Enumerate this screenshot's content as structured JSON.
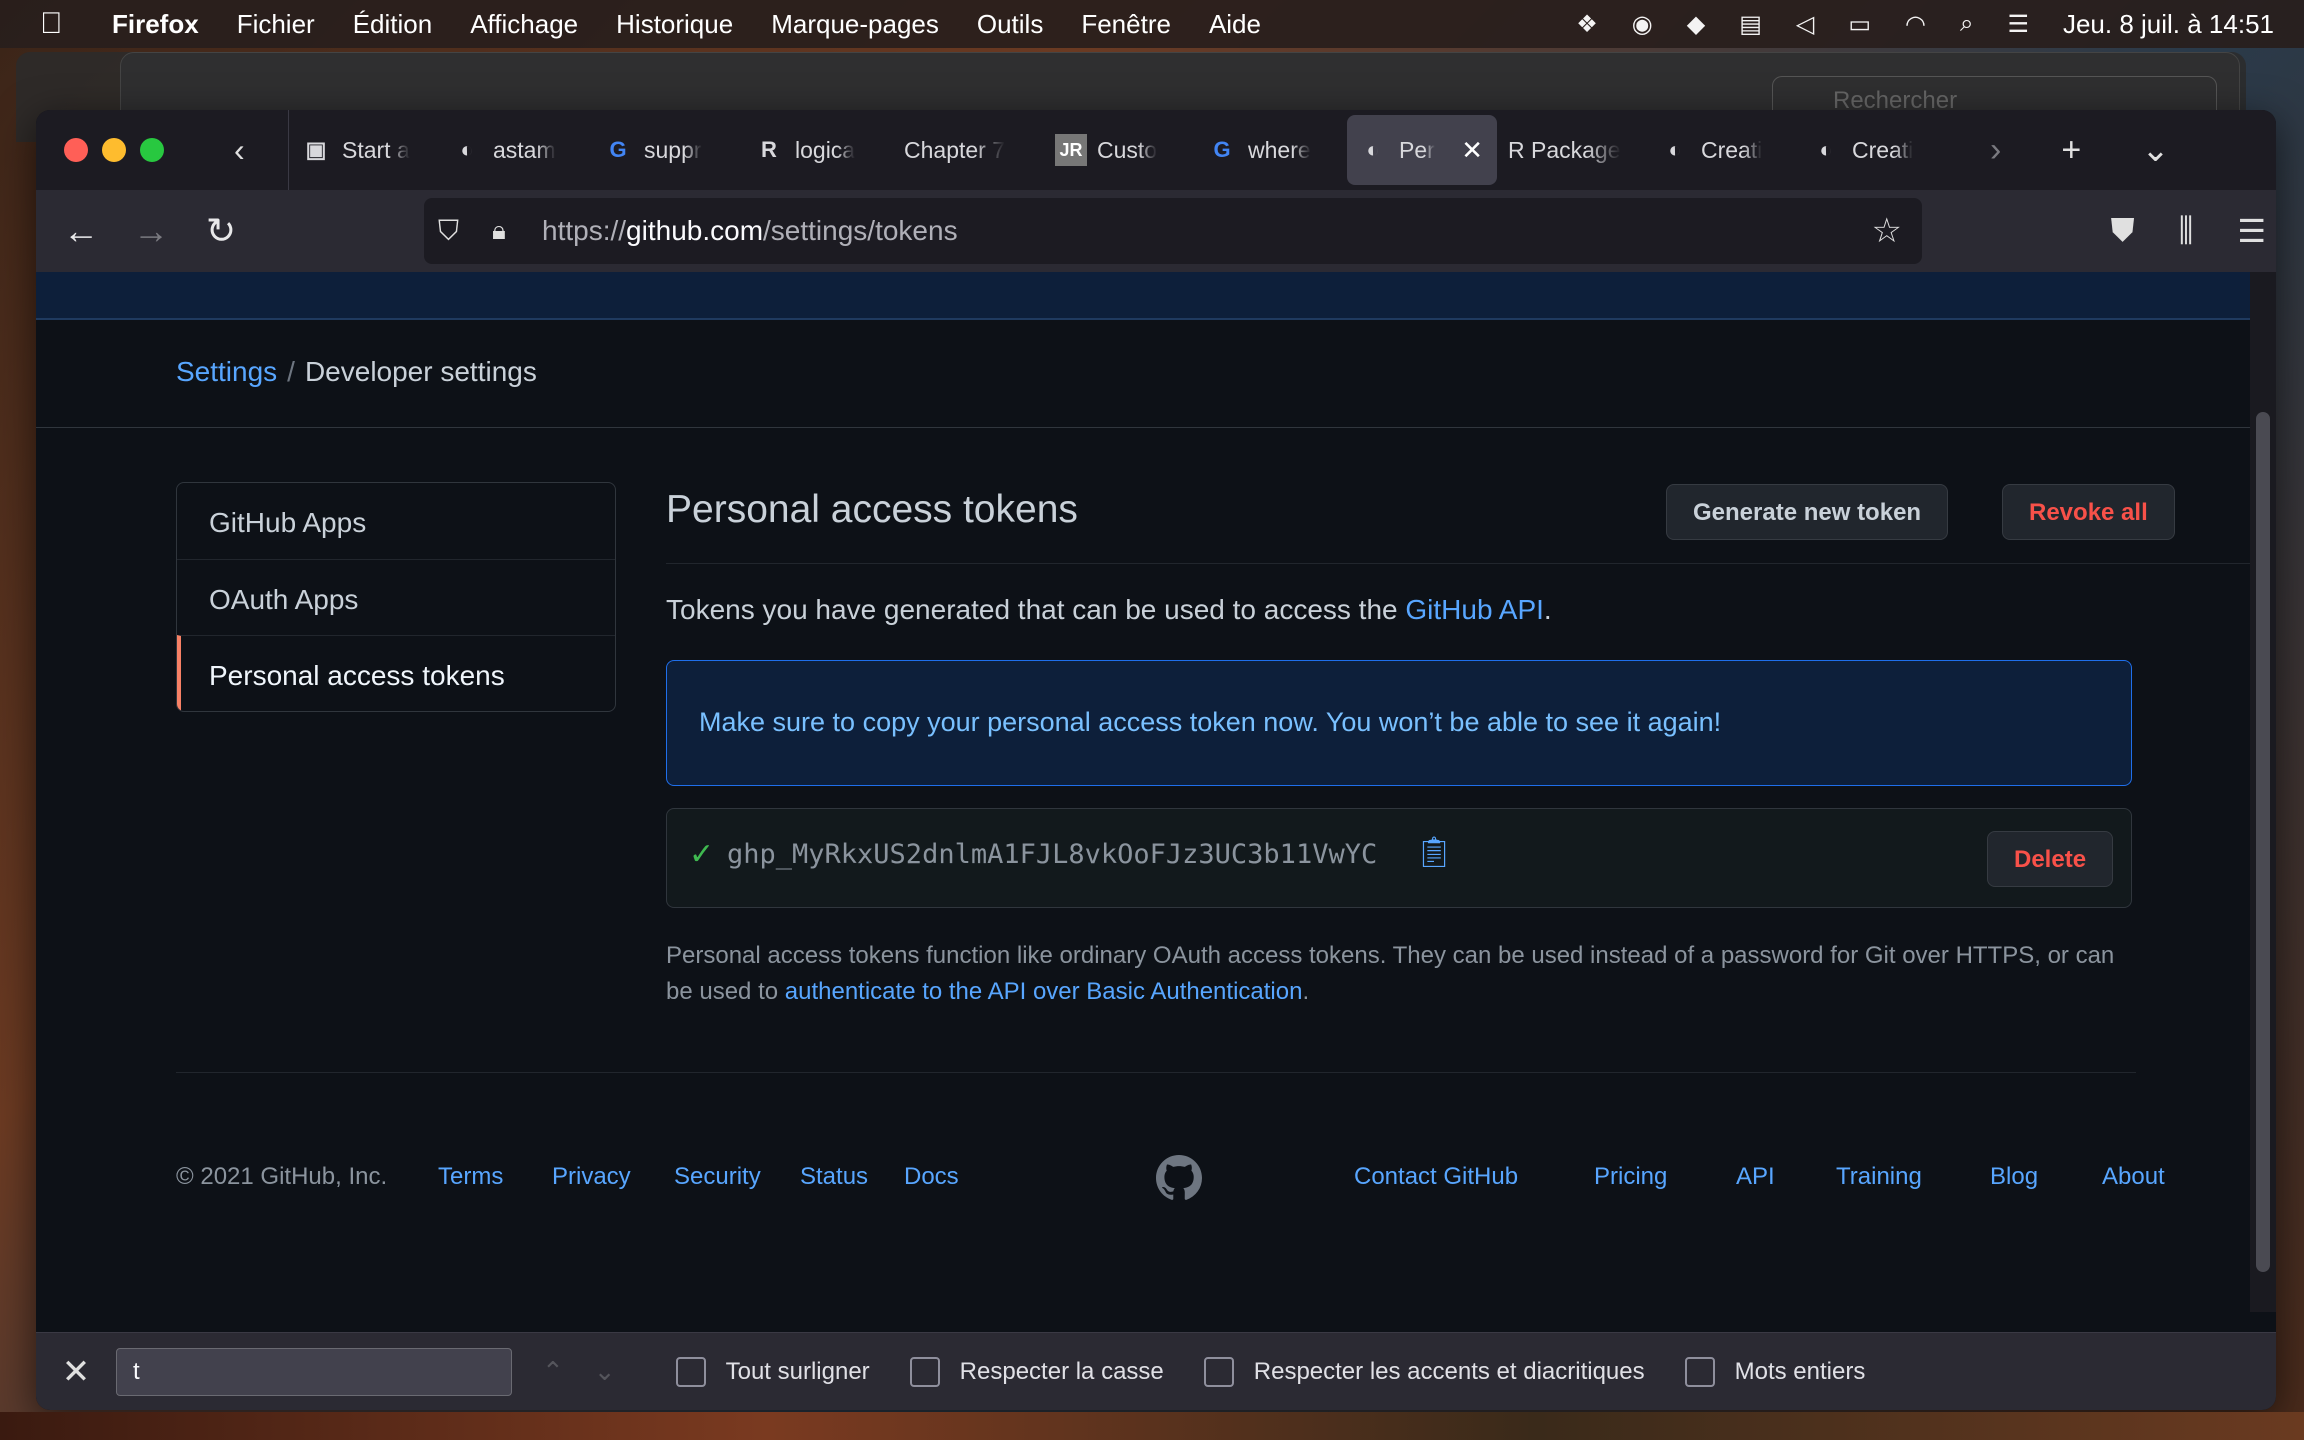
{
  "menubar": {
    "apple": "",
    "app": "Firefox",
    "items": [
      "Fichier",
      "Édition",
      "Affichage",
      "Historique",
      "Marque-pages",
      "Outils",
      "Fenêtre",
      "Aide"
    ],
    "clock": "Jeu. 8 juil. à  14:51"
  },
  "bg_window": {
    "search_placeholder": "Rechercher"
  },
  "tabs": [
    {
      "label": "Start a",
      "fav": "▣"
    },
    {
      "label": "astam",
      "fav": "◐"
    },
    {
      "label": "suppr",
      "fav": "G"
    },
    {
      "label": "logica",
      "fav": "R"
    },
    {
      "label": "Chapter 7",
      "fav": ""
    },
    {
      "label": "Custo",
      "fav": "JR"
    },
    {
      "label": "where",
      "fav": "G"
    },
    {
      "label": "Per",
      "fav": "◐",
      "active": true
    },
    {
      "label": "R Package",
      "fav": ""
    },
    {
      "label": "Creati",
      "fav": "◐"
    },
    {
      "label": "Creati",
      "fav": "◐"
    }
  ],
  "urlbar": {
    "prefix": "https://",
    "host": "github.com",
    "path": "/settings/tokens"
  },
  "breadcrumb": {
    "link": "Settings",
    "separator": "/",
    "current": "Developer settings"
  },
  "sidenav": [
    "GitHub Apps",
    "OAuth Apps",
    "Personal access tokens"
  ],
  "main": {
    "title": "Personal access tokens",
    "generate_button": "Generate new token",
    "revoke_button": "Revoke all",
    "desc_prefix": "Tokens you have generated that can be used to access the ",
    "desc_link": "GitHub API",
    "desc_suffix": ".",
    "flash": "Make sure to copy your personal access token now. You won’t be able to see it again!",
    "token": "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",
    "delete_button": "Delete",
    "note_prefix": "Personal access tokens function like ordinary OAuth access tokens. They can be used instead of a password for Git over HTTPS, or can be used to ",
    "note_link": "authenticate to the API over Basic Authentication",
    "note_suffix": "."
  },
  "footer": {
    "copyright": "© 2021 GitHub, Inc.",
    "left_links": [
      "Terms",
      "Privacy",
      "Security",
      "Status",
      "Docs"
    ],
    "right_links": [
      "Contact GitHub",
      "Pricing",
      "API",
      "Training",
      "Blog",
      "About"
    ]
  },
  "findbar": {
    "value": "t",
    "options": [
      "Tout surligner",
      "Respecter la casse",
      "Respecter les accents et diacritiques",
      "Mots entiers"
    ]
  }
}
